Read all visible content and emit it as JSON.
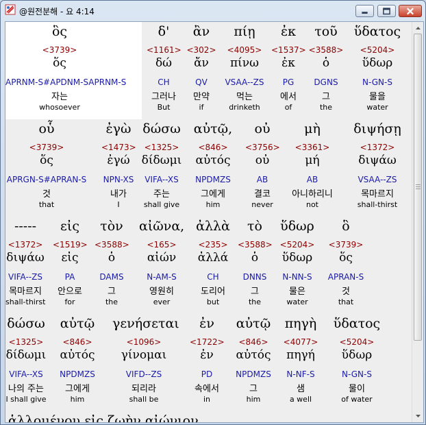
{
  "window": {
    "title": "@원전분해 - 요 4:14"
  },
  "rows": [
    {
      "cells": [
        {
          "w": "ὃς",
          "num": "<3739>",
          "lemma": "ὅς",
          "parse": "APRNM-S#APDNM-SAPRNM-S",
          "kor": "자는",
          "eng": "whosoever"
        },
        {
          "w": "δ'",
          "num": "<1161>",
          "lemma": "δώ",
          "parse": "CH",
          "kor": "그러나",
          "eng": "But"
        },
        {
          "w": "ἂν",
          "num": "<302>",
          "lemma": "ἄν",
          "parse": "QV",
          "kor": "만약",
          "eng": "if"
        },
        {
          "w": "πίῃ",
          "num": "<4095>",
          "lemma": "πίνω",
          "parse": "VSAA--ZS",
          "kor": "먹는",
          "eng": "drinketh"
        },
        {
          "w": "ἐκ",
          "num": "<1537>",
          "lemma": "ἐκ",
          "parse": "PG",
          "kor": "에서",
          "eng": "of"
        },
        {
          "w": "τοῦ",
          "num": "<3588>",
          "lemma": "ὁ",
          "parse": "DGNS",
          "kor": "그",
          "eng": "the"
        },
        {
          "w": "ὕδατος",
          "num": "<5204>",
          "lemma": "ὕδωρ",
          "parse": "N-GN-S",
          "kor": "물을",
          "eng": "water"
        }
      ]
    },
    {
      "cells": [
        {
          "w": "οὗ",
          "num": "<3739>",
          "lemma": "ὅς",
          "parse": "APRGN-S#APRAN-S",
          "kor": "것",
          "eng": "that"
        },
        {
          "w": "ἐγὼ",
          "num": "<1473>",
          "lemma": "ἐγώ",
          "parse": "NPN-XS",
          "kor": "내가",
          "eng": "I"
        },
        {
          "w": "δώσω",
          "num": "<1325>",
          "lemma": "δίδωμι",
          "parse": "VIFA--XS",
          "kor": "주는",
          "eng": "shall give"
        },
        {
          "w": "αὐτῷ,",
          "num": "<846>",
          "lemma": "αὐτός",
          "parse": "NPDMZS",
          "kor": "그에게",
          "eng": "him"
        },
        {
          "w": "οὐ",
          "num": "<3756>",
          "lemma": "οὐ",
          "parse": "AB",
          "kor": "결코",
          "eng": "never"
        },
        {
          "w": "μὴ",
          "num": "<3361>",
          "lemma": "μή",
          "parse": "AB",
          "kor": "아니하리니",
          "eng": "not"
        },
        {
          "w": "διψήσῃ",
          "num": "<1372>",
          "lemma": "διψάω",
          "parse": "VSAA--ZS",
          "kor": "목마르지",
          "eng": "shall-thirst"
        }
      ]
    },
    {
      "cells": [
        {
          "w": "-----",
          "num": "<1372>",
          "lemma": "διψάω",
          "parse": "VIFA--ZS",
          "kor": "목마르지",
          "eng": "shall-thirst"
        },
        {
          "w": "εἰς",
          "num": "<1519>",
          "lemma": "εἰς",
          "parse": "PA",
          "kor": "안으로",
          "eng": "for"
        },
        {
          "w": "τὸν",
          "num": "<3588>",
          "lemma": "ὁ",
          "parse": "DAMS",
          "kor": "그",
          "eng": "the"
        },
        {
          "w": "αἰῶνα,",
          "num": "<165>",
          "lemma": "αἰών",
          "parse": "N-AM-S",
          "kor": "영원히",
          "eng": "ever"
        },
        {
          "w": "ἀλλὰ",
          "num": "<235>",
          "lemma": "ἀλλά",
          "parse": "CH",
          "kor": "도리어",
          "eng": "but"
        },
        {
          "w": "τὸ",
          "num": "<3588>",
          "lemma": "ὁ",
          "parse": "DNNS",
          "kor": "그",
          "eng": "the"
        },
        {
          "w": "ὕδωρ",
          "num": "<5204>",
          "lemma": "ὕδωρ",
          "parse": "N-NN-S",
          "kor": "물은",
          "eng": "water"
        },
        {
          "w": "ὃ",
          "num": "<3739>",
          "lemma": "ὅς",
          "parse": "APRAN-S",
          "kor": "것",
          "eng": "that"
        }
      ]
    },
    {
      "cells": [
        {
          "w": "δώσω",
          "num": "<1325>",
          "lemma": "δίδωμι",
          "parse": "VIFA--XS",
          "kor": "나의 주는",
          "eng": "I shall give"
        },
        {
          "w": "αὐτῷ",
          "num": "<846>",
          "lemma": "αὐτός",
          "parse": "NPDMZS",
          "kor": "그에게",
          "eng": "him"
        },
        {
          "w": "γενήσεται",
          "num": "<1096>",
          "lemma": "γίνομαι",
          "parse": "VIFD--ZS",
          "kor": "되리라",
          "eng": "shall be"
        },
        {
          "w": "ἐν",
          "num": "<1722>",
          "lemma": "ἐν",
          "parse": "PD",
          "kor": "속에서",
          "eng": "in"
        },
        {
          "w": "αὐτῷ",
          "num": "<846>",
          "lemma": "αὐτός",
          "parse": "NPDMZS",
          "kor": "그",
          "eng": "him"
        },
        {
          "w": "πηγὴ",
          "num": "<4077>",
          "lemma": "πηγή",
          "parse": "N-NF-S",
          "kor": "샘",
          "eng": "a well"
        },
        {
          "w": "ὕδατος",
          "num": "<5204>",
          "lemma": "ὕδωρ",
          "parse": "N-GN-S",
          "kor": "물이",
          "eng": "of water"
        }
      ]
    },
    {
      "partial": "ἁλλομένου  εἰς  ζωὴν  αἰώνιον"
    }
  ],
  "colors": {
    "strongs": "#8b0000",
    "parsing": "#1a1aa8",
    "selected_bg": "#ffffff",
    "panel_bg": "#eeeeee"
  }
}
